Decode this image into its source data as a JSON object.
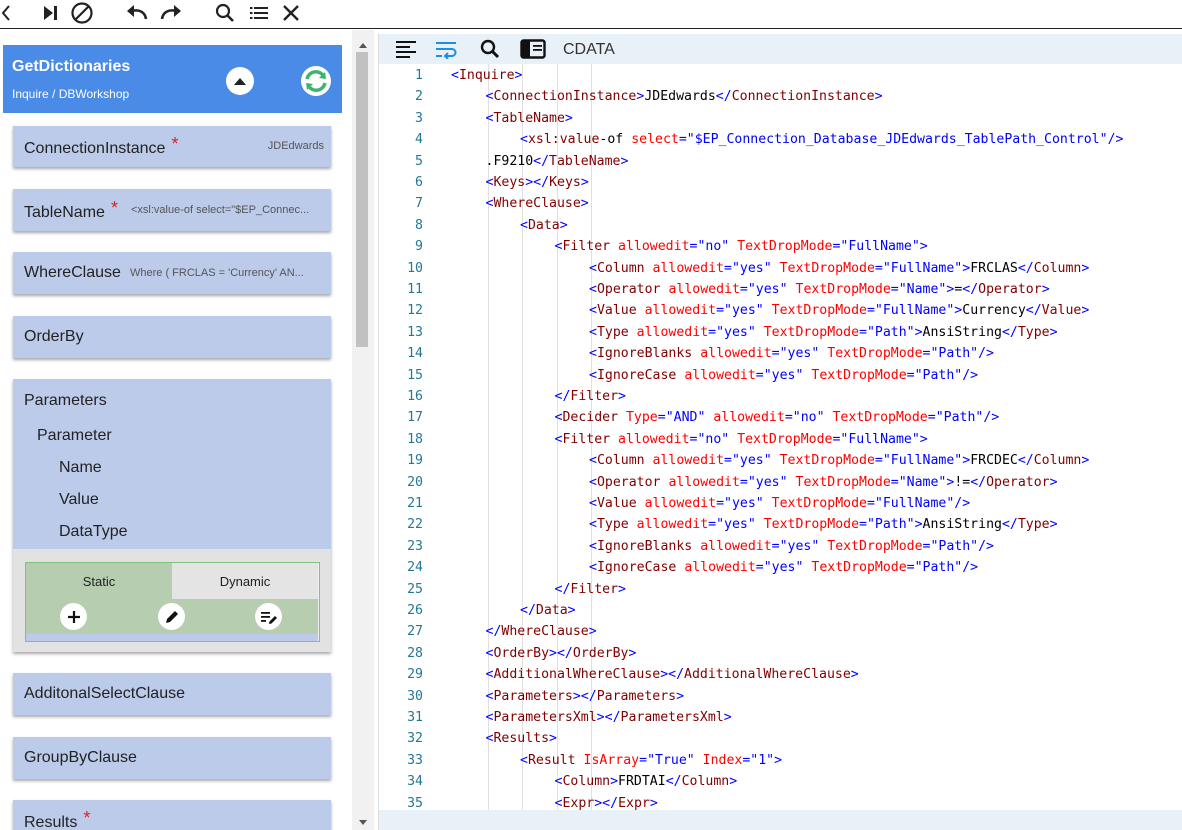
{
  "toolbar": {
    "icons": [
      "chevron-left-icon",
      "step-over-icon",
      "stop-icon",
      "undo-icon",
      "redo-icon",
      "search-icon",
      "list-icon",
      "close-icon"
    ]
  },
  "header": {
    "title": "GetDictionaries",
    "subtitle": "Inquire / DBWorkshop"
  },
  "fields": [
    {
      "label": "ConnectionInstance",
      "required": true,
      "value": "JDEdwards"
    },
    {
      "label": "TableName",
      "required": true,
      "value": "<xsl:value-of select=\"$EP_Connec..."
    },
    {
      "label": "WhereClause",
      "required": false,
      "value": "Where ( FRCLAS = 'Currency' AN..."
    },
    {
      "label": "OrderBy",
      "required": false,
      "value": ""
    },
    {
      "label": "AdditonalSelectClause",
      "required": false,
      "value": ""
    },
    {
      "label": "GroupByClause",
      "required": false,
      "value": ""
    },
    {
      "label": "Results",
      "required": true,
      "value": ""
    }
  ],
  "required_mark": "*",
  "parameters": {
    "label": "Parameters",
    "parameter": "Parameter",
    "children": [
      "Name",
      "Value",
      "DataType"
    ],
    "tabs": {
      "static": "Static",
      "dynamic": "Dynamic"
    }
  },
  "editor": {
    "cdata_label": "CDATA",
    "colors": {
      "tag": "#800000",
      "attr": "#ff0000",
      "string": "#0000ff",
      "linenum": "#237893"
    }
  }
}
